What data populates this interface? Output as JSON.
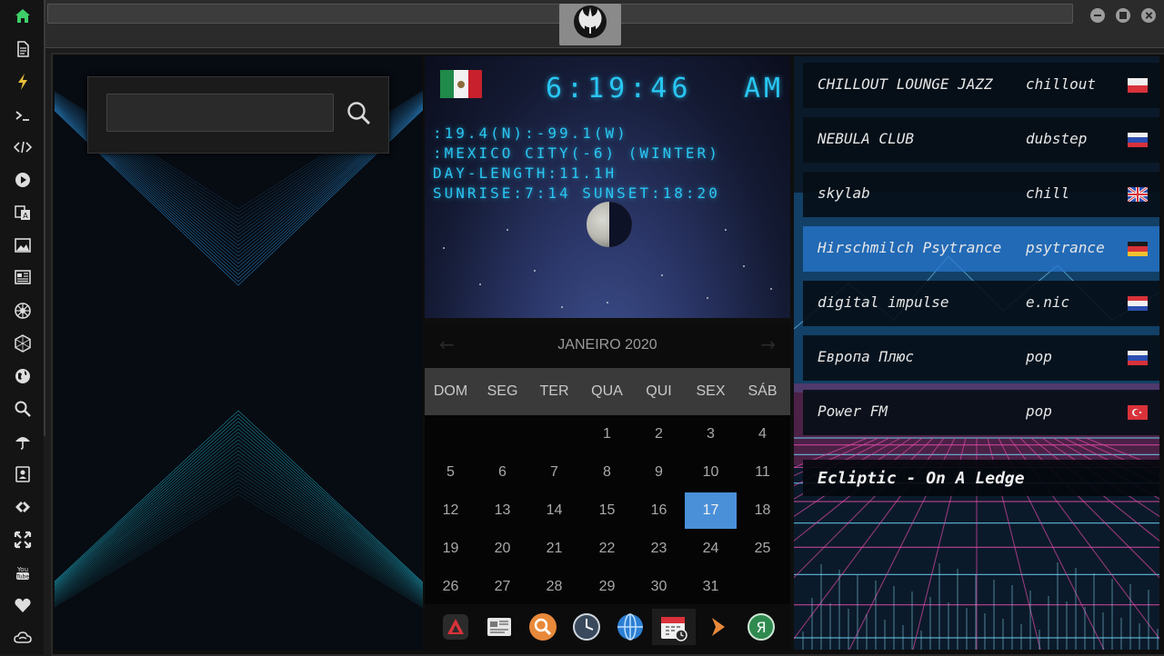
{
  "window": {
    "title": ""
  },
  "search": {
    "placeholder": "",
    "value": ""
  },
  "clock": {
    "time": "6:19:46",
    "ampm": "AM",
    "coords": ":19.4(N):-99.1(W)",
    "city": ":MEXICO CITY(-6) (WINTER)",
    "day_length": "DAY-LENGTH:11.1H",
    "sun": "SUNRISE:7:14 SUNSET:18:20"
  },
  "calendar": {
    "title": "JANEIRO 2020",
    "weekdays": [
      "DOM",
      "SEG",
      "TER",
      "QUA",
      "QUI",
      "SEX",
      "SÁB"
    ],
    "days": [
      "1",
      "2",
      "3",
      "4",
      "5",
      "6",
      "7",
      "8",
      "9",
      "10",
      "11",
      "12",
      "13",
      "14",
      "15",
      "16",
      "17",
      "18",
      "19",
      "20",
      "21",
      "22",
      "23",
      "24",
      "25",
      "26",
      "27",
      "28",
      "29",
      "30",
      "31"
    ],
    "selected_day": "17",
    "first_weekday_index": 3
  },
  "stations": [
    {
      "name": "CHILLOUT LOUNGE JAZZ",
      "genre": "chillout",
      "flag": "poland"
    },
    {
      "name": "NEBULA CLUB",
      "genre": "dubstep",
      "flag": "russia"
    },
    {
      "name": "skylab",
      "genre": "chill",
      "flag": "uk"
    },
    {
      "name": "Hirschmilch Psytrance",
      "genre": "psytrance",
      "flag": "germany"
    },
    {
      "name": "digital impulse",
      "genre": "e.nic",
      "flag": "croatia"
    },
    {
      "name": "Европа Плюс",
      "genre": "pop",
      "flag": "russia"
    },
    {
      "name": "Power FM",
      "genre": "pop",
      "flag": "turkey"
    }
  ],
  "now_playing": "Ecliptic - On A Ledge",
  "colors": {
    "accent": "#4a90d9",
    "lcd": "#29c6f2",
    "sidebar_home": "#3ecf6a",
    "sidebar_flash": "#e8c13a"
  },
  "sidebar_icons": [
    "home-icon",
    "document-icon",
    "lightning-icon",
    "terminal-icon",
    "code-icon",
    "play-icon",
    "translate-icon",
    "image-icon",
    "news-icon",
    "empire-icon",
    "hexagon-icon",
    "globe-icon",
    "search-icon",
    "umbrella-icon",
    "contact-icon",
    "tag-icon",
    "expand-icon",
    "youtube-icon",
    "heart-icon",
    "cloud-icon"
  ],
  "dock_icons": [
    "app-launcher-icon",
    "news-reader-icon",
    "search-app-icon",
    "clock-app-icon",
    "web-browser-icon",
    "calendar-app-icon",
    "media-play-icon",
    "yandex-icon"
  ]
}
